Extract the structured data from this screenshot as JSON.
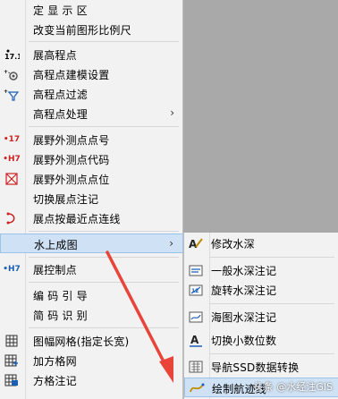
{
  "menu": {
    "items": [
      {
        "label": "定 显 示 区",
        "icon": ""
      },
      {
        "label": "改变当前图形比例尺",
        "icon": ""
      },
      {
        "label": "展高程点",
        "icon": "elevation-point-icon"
      },
      {
        "label": "高程点建模设置",
        "icon": "elevation-model-icon"
      },
      {
        "label": "高程点过滤",
        "icon": "elevation-filter-icon"
      },
      {
        "label": "高程点处理",
        "icon": "",
        "submenu": true
      },
      {
        "label": "展野外测点点号",
        "icon": "point-number-icon"
      },
      {
        "label": "展野外测点代码",
        "icon": "point-code-icon"
      },
      {
        "label": "展野外测点点位",
        "icon": "point-position-icon"
      },
      {
        "label": "切换展点注记",
        "icon": ""
      },
      {
        "label": "展点按最近点连线",
        "icon": "nearest-connect-icon"
      },
      {
        "label": "水上成图",
        "icon": "",
        "submenu": true,
        "highlighted": true
      },
      {
        "label": "展控制点",
        "icon": "control-point-icon"
      },
      {
        "label": "编 码 引 导",
        "icon": ""
      },
      {
        "label": "简 码 识 别",
        "icon": ""
      },
      {
        "label": "图幅网格(指定长宽)",
        "icon": "grid-icon"
      },
      {
        "label": "加方格网",
        "icon": "square-grid-icon"
      },
      {
        "label": "方格注记",
        "icon": "grid-note-icon"
      }
    ],
    "icon_text": {
      "elevation": "17.1",
      "point_number": "•17",
      "point_code": "•H7",
      "control_point": "•H7"
    }
  },
  "submenu": {
    "items": [
      {
        "label": "修改水深",
        "icon": "edit-depth-icon"
      },
      {
        "label": "一般水深注记",
        "icon": "depth-note-icon"
      },
      {
        "label": "旋转水深注记",
        "icon": "rotate-depth-icon"
      },
      {
        "label": "海图水深注记",
        "icon": "chart-depth-icon"
      },
      {
        "label": "切换小数位数",
        "icon": "decimal-icon"
      },
      {
        "label": "导航SSD数据转换",
        "icon": "ssd-convert-icon"
      },
      {
        "label": "绘制航迹线",
        "icon": "track-line-icon",
        "highlighted": true
      }
    ]
  },
  "watermark": "头条 @水经注GIS",
  "colors": {
    "highlight": "#cfe2f5",
    "arrow": "#e8443a",
    "menu_bg": "#f2f2f2",
    "background": "#a9a9a9"
  }
}
